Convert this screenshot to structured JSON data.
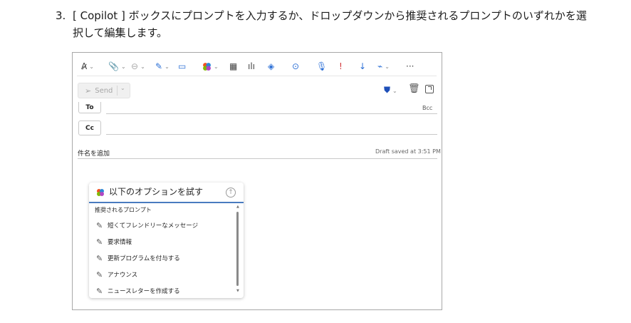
{
  "instruction": {
    "number": "3.",
    "text": "[ Copilot ] ボックスにプロンプトを入力するか、ドロップダウンから推奨されるプロンプトのいずれかを選択して編集します。"
  },
  "toolbar": {
    "more_label": "···"
  },
  "compose": {
    "send_label": "Send",
    "to_label": "To",
    "cc_label": "Cc",
    "bcc_label": "Bcc",
    "subject_placeholder": "件名を追加",
    "draft_status": "Draft saved at 3:51 PM"
  },
  "copilot": {
    "title": "以下のオプションを試す",
    "suggestions_header": "推奨されるプロンプト",
    "items": [
      "短くてフレンドリーなメッセージ",
      "要求情報",
      "更新プログラムを付与する",
      "アナウンス",
      "ニュースレターを作成する"
    ]
  },
  "colors": {
    "accent": "#2b6fd6",
    "underline": "#4a7bbf",
    "protect": "#1f4fb8"
  }
}
